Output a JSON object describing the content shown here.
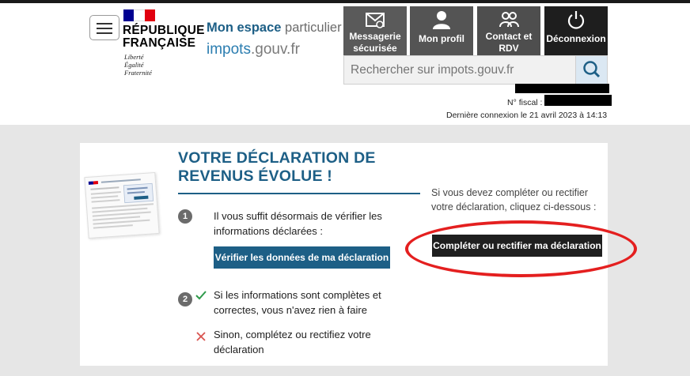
{
  "header": {
    "brand_line1": "RÉPUBLIQUE",
    "brand_line2": "FRANÇAISE",
    "motto": [
      "Liberté",
      "Égalité",
      "Fraternité"
    ],
    "space_bold": "Mon espace",
    "space_light": "particulier",
    "site_part1": "impots",
    "site_part2": ".gouv.fr"
  },
  "nav": {
    "messagerie_line1": "Messagerie",
    "messagerie_line2": "sécurisée",
    "profil": "Mon profil",
    "contact_line1": "Contact et",
    "contact_line2": "RDV",
    "deconnexion": "Déconnexion"
  },
  "search": {
    "placeholder": "Rechercher sur impots.gouv.fr"
  },
  "account": {
    "fiscal_label": "N° fiscal :",
    "last_connection": "Dernière connexion le 21 avril 2023 à 14:13"
  },
  "card": {
    "title": "VOTRE DÉCLARATION DE REVENUS ÉVOLUE !",
    "step1_num": "1",
    "step1_text": "Il vous suffit désormais de vérifier les informations déclarées :",
    "verify_button": "Vérifier les données de ma déclaration",
    "step2_num": "2",
    "step2_ok": "Si les informations sont complètes et correctes, vous n'avez rien à faire",
    "step2_ko": "Sinon, complétez ou rectifiez votre déclaration",
    "side_text": "Si vous devez compléter ou rectifier votre déclaration, cliquez ci-dessous :",
    "fix_button": "Compléter ou rectifier ma déclaration"
  },
  "colors": {
    "accent": "#1d5f86",
    "highlight": "#e41f1f",
    "check": "#2e9a4a",
    "cross": "#d9534f"
  }
}
